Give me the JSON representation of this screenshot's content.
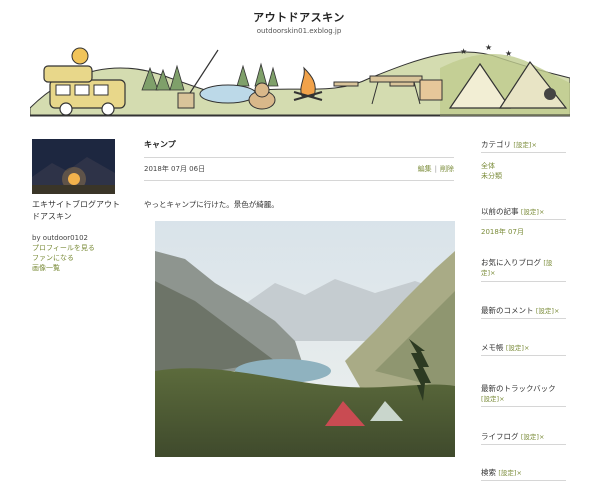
{
  "blog": {
    "title": "アウトドアスキン",
    "url": "outdoorskin01.exblog.jp"
  },
  "profile": {
    "name": "エキサイトブログアウトドアスキン",
    "by": "by outdoor0102",
    "links": [
      "プロフィールを見る",
      "ファンになる",
      "画像一覧"
    ]
  },
  "post": {
    "title": "キャンプ",
    "date": "2018年 07月 06日",
    "edit": "編集",
    "delete": "削除",
    "body": "やっとキャンプに行けた。景色が綺麗。"
  },
  "sidebar": {
    "setting_label": "[設定]",
    "sections": [
      {
        "title": "カテゴリ",
        "links": [
          "全体",
          "未分類"
        ]
      },
      {
        "title": "以前の記事",
        "links": [
          "2018年 07月"
        ]
      },
      {
        "title": "お気に入りブログ",
        "links": []
      },
      {
        "title": "最新のコメント",
        "links": []
      },
      {
        "title": "メモ帳",
        "links": []
      },
      {
        "title": "最新のトラックバック",
        "links": []
      },
      {
        "title": "ライフログ",
        "links": []
      },
      {
        "title": "検索",
        "links": []
      }
    ]
  },
  "colors": {
    "link": "#7b8c3a",
    "rule": "#d6d6d6",
    "header_green": "#cfd9a8",
    "van_yellow": "#e8d78a",
    "lake_blue": "#bcd9e8"
  }
}
